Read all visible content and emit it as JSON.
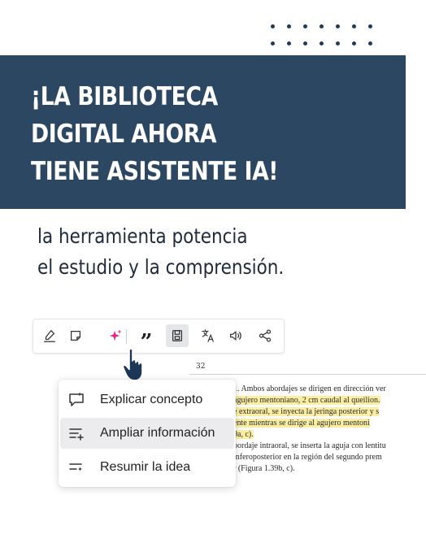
{
  "banner": {
    "headline_lines": [
      "¡LA BIBLIOTECA",
      "DIGITAL AHORA",
      "TIENE ASISTENTE IA!"
    ]
  },
  "subtitle_lines": [
    "la herramienta potencia",
    "el estudio y la comprensión."
  ],
  "toolbar": {
    "icons": [
      "highlighter-icon",
      "note-icon",
      "ai-sparkle-icon",
      "quote-icon",
      "save-icon",
      "translate-icon",
      "audio-icon",
      "share-icon"
    ],
    "quote_glyph": "”",
    "accent_color": "#e0248a"
  },
  "document": {
    "page_number": "32",
    "lines": [
      "1. Ambos abordajes se dirigen en dirección ver",
      "agujero mentoniano, 2 cm caudal al queilion.",
      "e extraoral, se inyecta la jeringa posterior y s",
      "ente mientras se dirige al agujero mentoni",
      "9a, c).",
      "bordaje intraoral, se inserta la aguja con lentitu",
      "inferoposterior en la región del segundo prem",
      "r (Figura 1.39b, c)."
    ]
  },
  "context_menu": {
    "items": [
      {
        "label": "Explicar concepto",
        "icon": "chat-explain-icon"
      },
      {
        "label": "Ampliar información",
        "icon": "list-add-icon"
      },
      {
        "label": "Resumir la idea",
        "icon": "list-summary-icon"
      }
    ]
  },
  "colors": {
    "banner": "#2b4762",
    "dots": "#1f3b5c",
    "highlight": "#fbeea2"
  }
}
